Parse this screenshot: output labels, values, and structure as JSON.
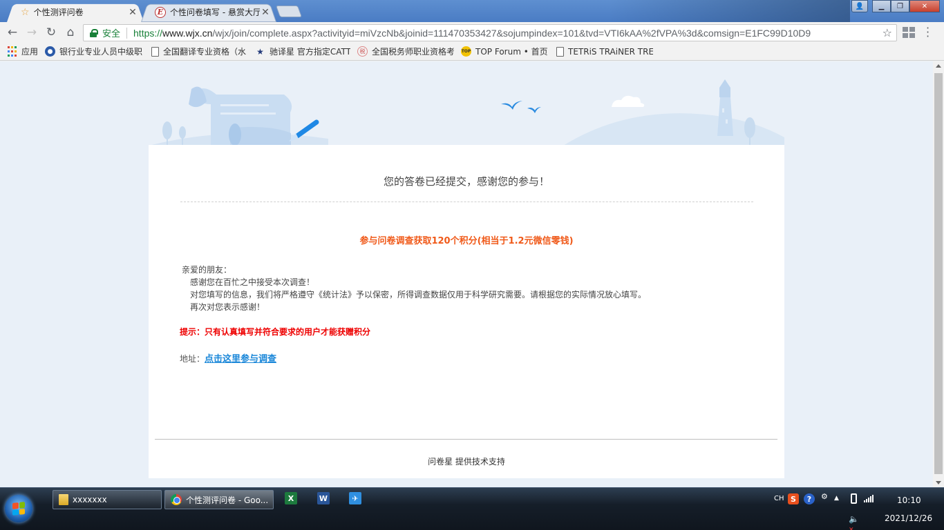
{
  "browser": {
    "tabs": [
      {
        "title": "个性测评问卷",
        "active": true,
        "icon": "star-icon"
      },
      {
        "title": "个性问卷填写 - 悬赏大厅",
        "active": false,
        "icon": "e-logo-icon"
      }
    ],
    "toolbar": {
      "secure_label": "安全",
      "url_protocol": "https://",
      "url_host": "www.wjx.cn",
      "url_rest": "/wjx/join/complete.aspx?activityid=miVzcNb&joinid=111470353427&sojumpindex=101&tvd=VTI6kAA%2fVPA%3d&comsign=E1FC99D10D9"
    },
    "bookmarks": [
      {
        "label": "应用",
        "icon": "apps-icon"
      },
      {
        "label": "银行业专业人员中级职",
        "icon": "globe-icon"
      },
      {
        "label": "全国翻译专业资格（水",
        "icon": "page-icon"
      },
      {
        "label": "驰译星 官方指定CATT",
        "icon": "star-logo-icon"
      },
      {
        "label": "全国税务师职业资格考",
        "icon": "seal-icon"
      },
      {
        "label": "TOP Forum • 首页",
        "icon": "top-forum-icon"
      },
      {
        "label": "TETRiS TRAiNER TRE",
        "icon": "page-icon"
      }
    ]
  },
  "page": {
    "submitted_title": "您的答卷已经提交，感谢您的参与！",
    "reward_text": "参与问卷调查获取120个积分(相当于1.2元微信零钱)",
    "letter": {
      "greeting": "亲爱的朋友：",
      "line1": "感谢您在百忙之中接受本次调查！",
      "line2": "对您填写的信息，我们将严格遵守《统计法》予以保密，所得调查数据仅用于科学研究需要。请根据您的实际情况放心填写。",
      "line3": "再次对您表示感谢！"
    },
    "tip": "提示：只有认真填写并符合要求的用户才能获赠积分",
    "address_label": "地址：",
    "address_link": "点击这里参与调查",
    "support": "问卷星 提供技术支持"
  },
  "taskbar": {
    "items": [
      {
        "label": "xxxxxxx",
        "icon": "folder-icon"
      },
      {
        "label": "个性测评问卷 - Goo...",
        "icon": "chrome-icon"
      }
    ],
    "pinned": [
      {
        "name": "excel-icon",
        "glyph": "X"
      },
      {
        "name": "word-icon",
        "glyph": "W"
      },
      {
        "name": "bird-icon",
        "glyph": "✈"
      }
    ],
    "tray": {
      "lang": "CH",
      "sogou_glyph": "S",
      "help_glyph": "?",
      "time": "10:10",
      "date": "2021/12/26"
    }
  },
  "colors": {
    "secure_green": "#188038",
    "reward_orange": "#f05a1a",
    "tip_red": "#e00000",
    "link_blue": "#1a87d9",
    "page_bg": "#e9f0f8"
  }
}
